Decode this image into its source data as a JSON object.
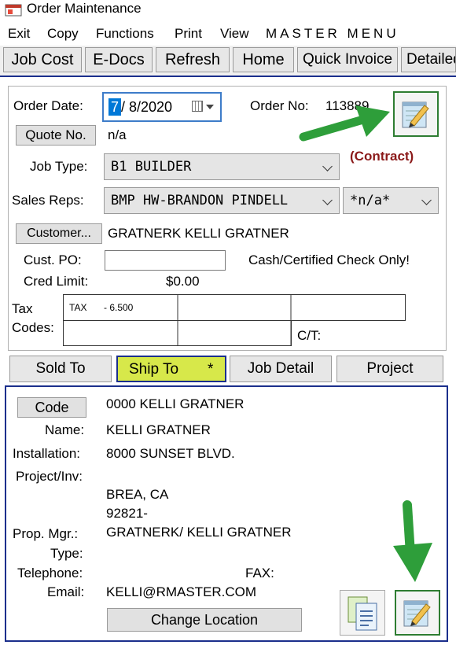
{
  "window": {
    "title": "Order Maintenance"
  },
  "menu": {
    "items": [
      "Exit",
      "Copy",
      "Functions",
      "Print",
      "View"
    ],
    "brand": "MASTER MENU"
  },
  "toolbar": {
    "buttons": [
      "Job Cost",
      "E-Docs",
      "Refresh",
      "Home",
      "Quick Invoice",
      "Detailed"
    ]
  },
  "order": {
    "date_label": "Order Date:",
    "date_month": "7",
    "date_rest": "/  8/2020",
    "number_label": "Order No:",
    "number": "113889",
    "contract_label": "(Contract)",
    "quote_button": "Quote No.",
    "quote_value": "n/a",
    "job_type_label": "Job Type:",
    "job_type_value": "B1 BUILDER",
    "sales_reps_label": "Sales Reps:",
    "sales_rep_value": "BMP HW-BRANDON PINDELL",
    "sales_rep2_value": "*n/a*",
    "customer_button": "Customer...",
    "customer_value": "GRATNERK  KELLI GRATNER",
    "cust_po_label": "Cust. PO:",
    "cust_po_value": "",
    "cash_note": "Cash/Certified Check Only!",
    "cred_limit_label": "Cred Limit:",
    "cred_limit_value": "$0.00",
    "tax_label_1": "Tax",
    "tax_label_2": "Codes:",
    "tax_code": "TAX",
    "tax_rate": "- 6.500",
    "ct_label": "C/T:"
  },
  "tabs": [
    "Sold To",
    "Ship To",
    "*",
    "Job Detail",
    "Project"
  ],
  "ship_to": {
    "code_button": "Code",
    "code_value": "0000 KELLI GRATNER",
    "name_label": "Name:",
    "name_value": "KELLI GRATNER",
    "installation_label": "Installation:",
    "installation_value": "8000 SUNSET BLVD.",
    "project_label": "Project/Inv:",
    "city_state": "BREA, CA",
    "zip": "92821-",
    "prop_mgr_label": "Prop. Mgr.:",
    "prop_mgr_value": "GRATNERK/ KELLI GRATNER",
    "type_label": "Type:",
    "telephone_label": "Telephone:",
    "fax_label": "FAX:",
    "email_label": "Email:",
    "email_value": "KELLI@RMASTER.COM",
    "change_location_button": "Change Location"
  },
  "icons": {
    "app": "app-window-icon",
    "notepad": "notepad-pencil-icon",
    "documents": "documents-icon",
    "arrow": "green-arrow-icon"
  },
  "colors": {
    "accent": "#1b2f8c",
    "active_tab": "#d7e84a",
    "contract": "#8b1a1a",
    "arrow": "#2e9e3a"
  }
}
